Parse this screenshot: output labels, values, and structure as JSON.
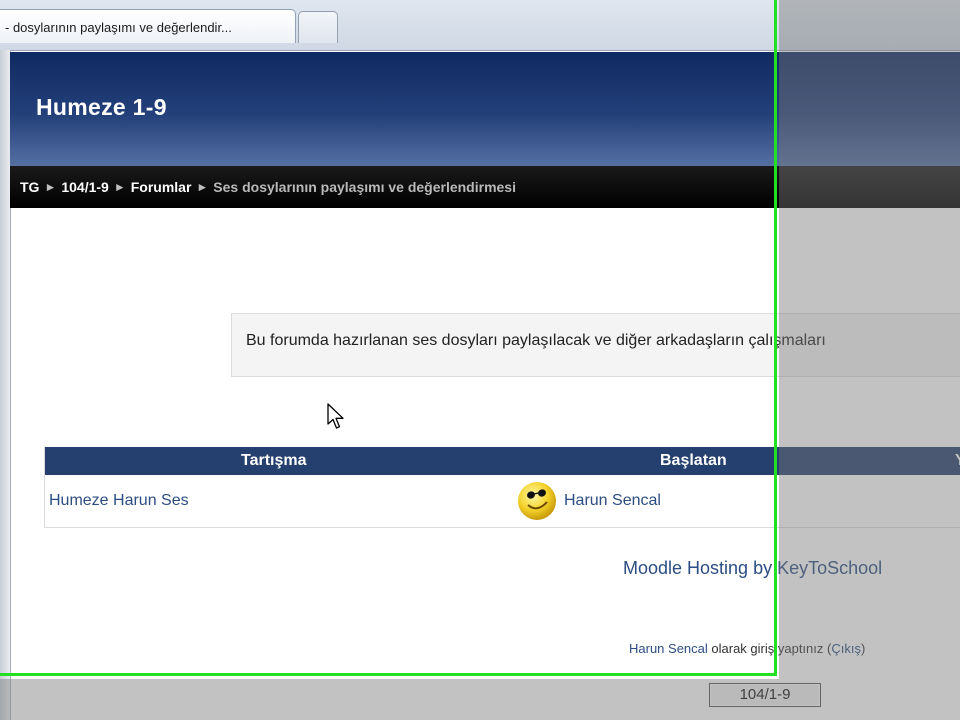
{
  "browser": {
    "active_tab_title": "- dosylarının paylaşımı ve değerlendir..."
  },
  "header": {
    "site_title": "Humeze 1-9"
  },
  "breadcrumb": {
    "items": [
      "TG",
      "104/1-9",
      "Forumlar"
    ],
    "current": "Ses dosylarının paylaşımı ve değerlendirmesi",
    "separator": "►"
  },
  "intro": {
    "text": "Bu forumda hazırlanan ses dosyları paylaşılacak ve diğer arkadaşların çalışmaları"
  },
  "table": {
    "columns": [
      "Tartışma",
      "Başlatan",
      "Y"
    ],
    "rows": [
      {
        "discussion": "Humeze Harun Ses",
        "started_by": "Harun Sencal"
      }
    ]
  },
  "footer": {
    "hosting": "Moodle Hosting by KeyToSchool",
    "login_user": "Harun Sencal",
    "login_text": " olarak giriş yaptınız (",
    "logout": "Çıkış",
    "login_close": ")",
    "course_button": "104/1-9"
  },
  "colors": {
    "header_dark": "#0f2a63",
    "table_header": "#253f6e",
    "link": "#2c4d84",
    "recording_frame": "#22e022"
  }
}
